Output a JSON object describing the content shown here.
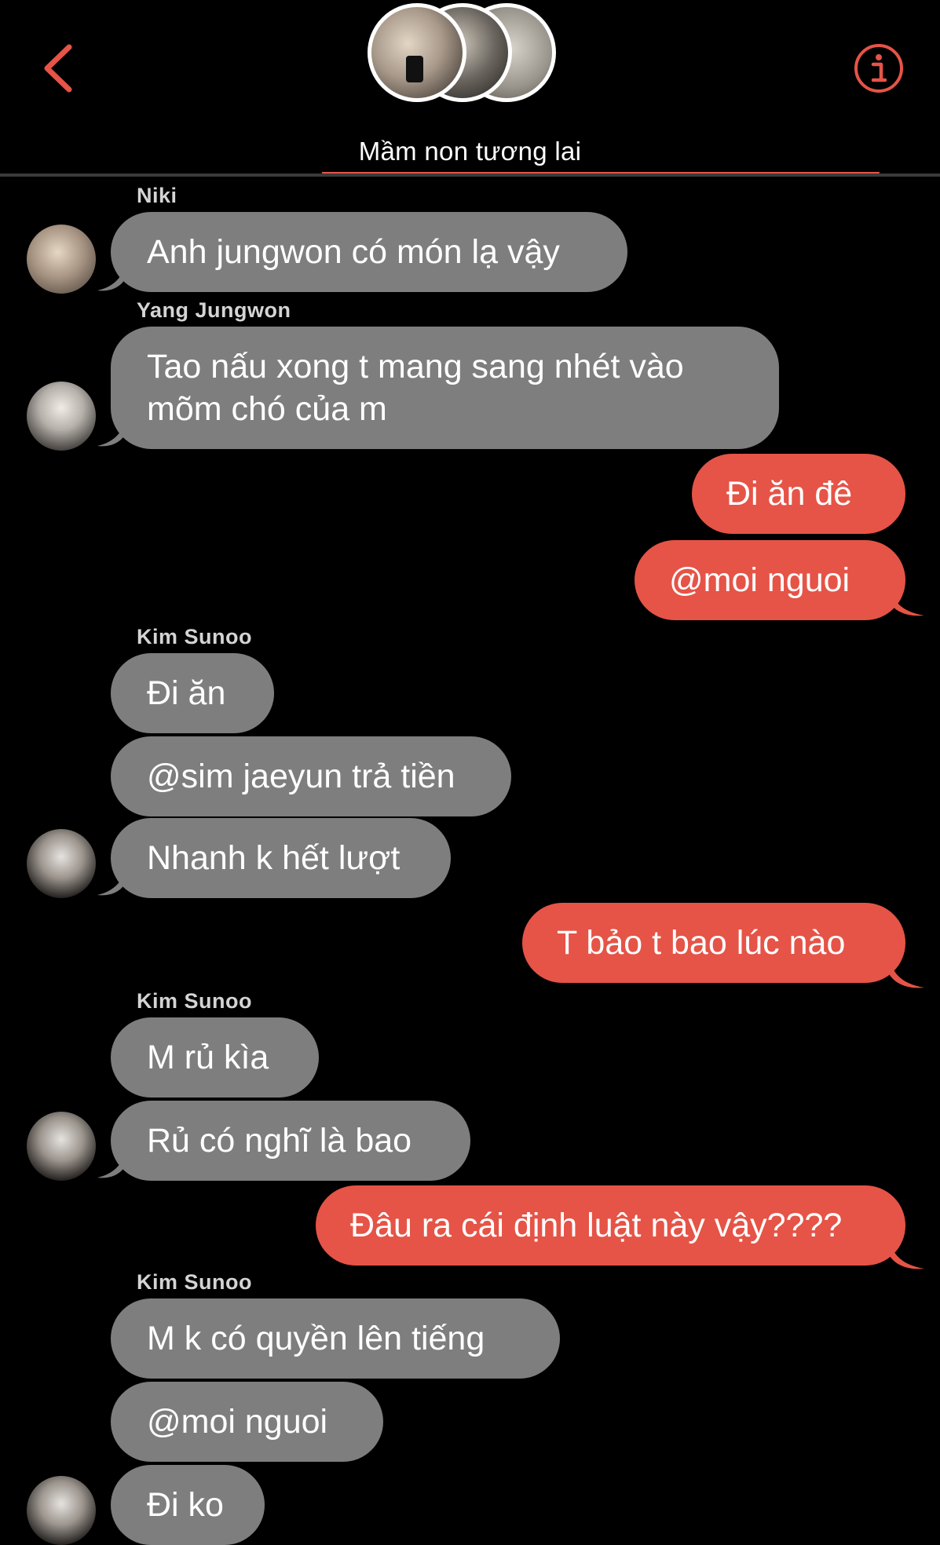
{
  "header": {
    "group_name": "Mầm non tương lai",
    "back_icon": "chevron-left-icon",
    "info_icon": "info-icon",
    "accent_color": "#e55447"
  },
  "messages": [
    {
      "type": "received",
      "sender": "Niki",
      "text": "Anh jungwon có món lạ vậy"
    },
    {
      "type": "received",
      "sender": "Yang Jungwon",
      "lines": [
        " Tao nấu xong t mang sang nhét vào",
        "mõm chó của m"
      ]
    },
    {
      "type": "sent",
      "text": "Đi ăn đê"
    },
    {
      "type": "sent",
      "text": "@moi nguoi"
    },
    {
      "type": "received",
      "sender": "Kim Sunoo",
      "text": "Đi ăn"
    },
    {
      "type": "received",
      "text": "@sim jaeyun trả tiền"
    },
    {
      "type": "received",
      "text": "Nhanh k hết lượt"
    },
    {
      "type": "sent",
      "text": "T bảo t bao lúc nào"
    },
    {
      "type": "received",
      "sender": "Kim Sunoo",
      "text": "M rủ kìa"
    },
    {
      "type": "received",
      "text": "Rủ có nghĩ là bao"
    },
    {
      "type": "sent",
      "text": "Đâu ra cái định luật này vậy????"
    },
    {
      "type": "received",
      "sender": "Kim Sunoo",
      "text": "M k có quyền lên tiếng"
    },
    {
      "type": "received",
      "text": "@moi nguoi"
    },
    {
      "type": "received",
      "text": "Đi ko"
    }
  ]
}
